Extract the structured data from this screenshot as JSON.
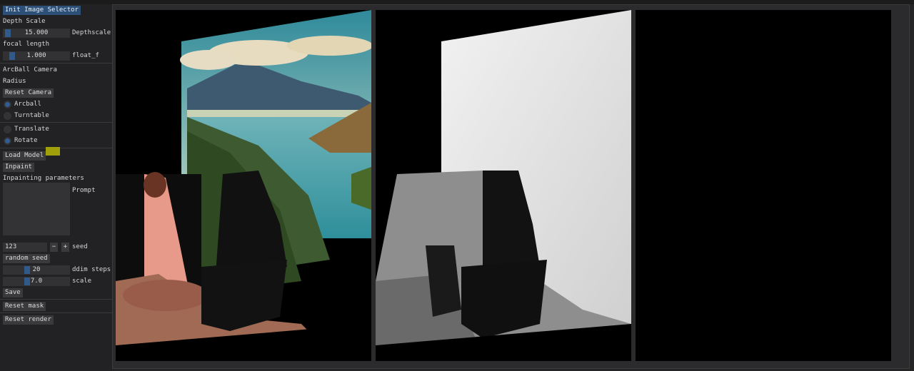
{
  "sidebar": {
    "init_button": "Init Image Selector",
    "depth_scale_heading": "Depth Scale",
    "depth_value": "15.000",
    "depth_label": "Depthscale",
    "focal_heading": "focal length",
    "focal_value": "1.000",
    "focal_label": "float_f",
    "arcball_heading": "ArcBall Camera",
    "radius_label": "Radius",
    "reset_camera": "Reset Camera",
    "mode_arcball": "Arcball",
    "mode_turntable": "Turntable",
    "op_translate": "Translate",
    "op_rotate": "Rotate",
    "load_model": "Load Model",
    "inpaint": "Inpaint",
    "inpaint_params": "Inpainting parameters",
    "prompt_label": "Prompt",
    "seed_value": "123",
    "minus": "−",
    "plus": "+",
    "seed_label": "seed",
    "random_seed": "random seed",
    "ddim_value": "20",
    "ddim_label": "ddim steps",
    "scale_value": "7.0",
    "scale_label": "scale",
    "save": "Save",
    "reset_mask": "Reset mask",
    "reset_render": "Reset render",
    "model_color": "#a0a00a"
  }
}
